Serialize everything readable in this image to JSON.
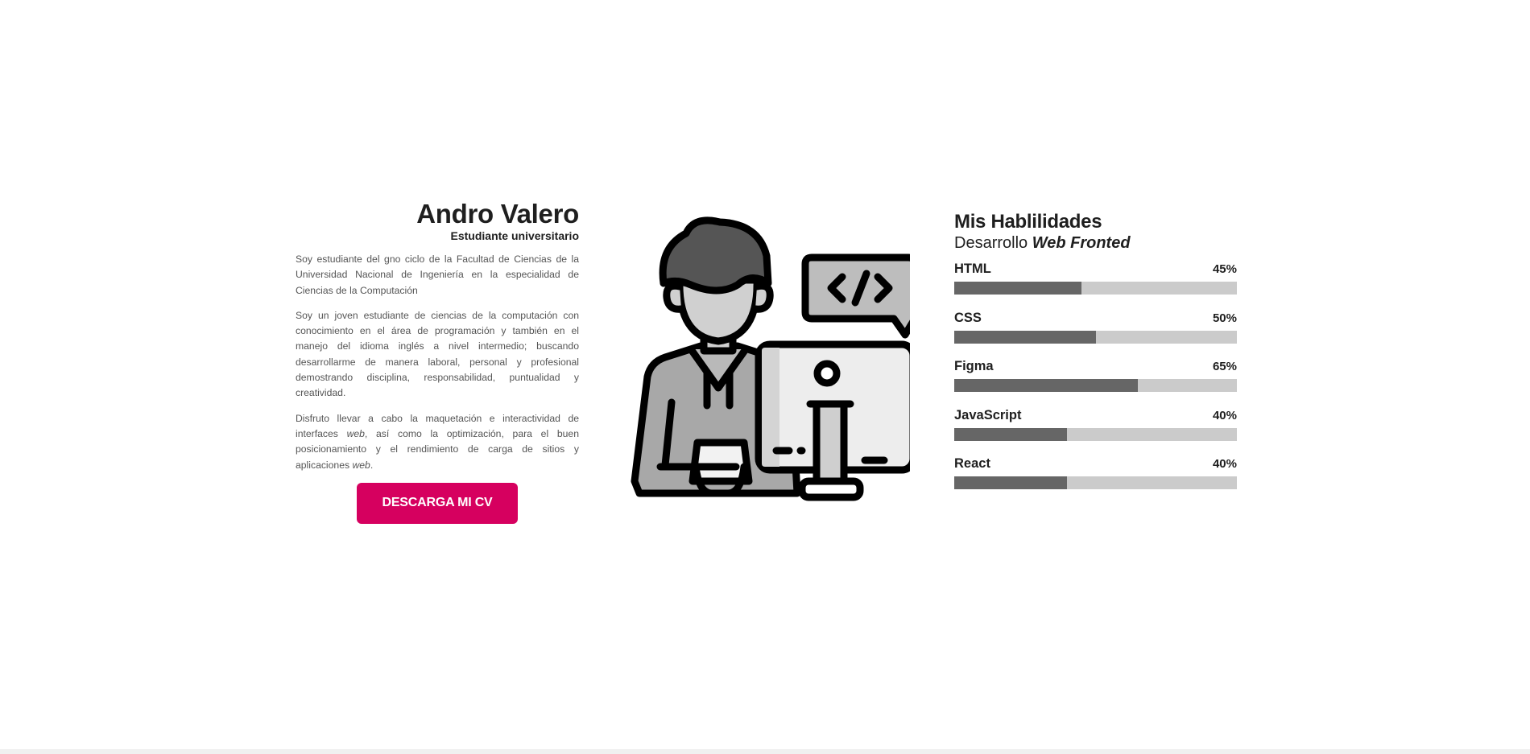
{
  "profile": {
    "name": "Andro Valero",
    "role": "Estudiante universitario",
    "paragraph_1": "Soy estudiante del gno ciclo de la Facultad de Ciencias de la Universidad Nacional de Ingeniería en la especialidad de Ciencias de la Computación",
    "paragraph_2": "Soy un joven estudiante de ciencias de la computación con conocimiento en el área de programación y también en el manejo del idioma inglés a nivel intermedio; buscando desarrollarme de manera laboral, personal y profesional demostrando disciplina, responsabilidad, puntualidad y creatividad.",
    "paragraph_3": {
      "part_1": "Disfruto llevar a cabo la maquetación e interactividad de interfaces ",
      "em_1": "web",
      "part_2": ", así como la optimización, para el buen posicionamiento y el rendimiento de carga de sitios y aplicaciones ",
      "em_2": "web",
      "part_3": "."
    },
    "cv_button_label": "DESCARGA MI CV"
  },
  "illustration": {
    "icon": "developer-at-computer-icon",
    "code_bubble_text": "</>"
  },
  "skills": {
    "title": "Mis Hablilidades",
    "subtitle_prefix": "Desarrollo ",
    "subtitle_emphasis": "Web Fronted",
    "items": [
      {
        "name": "HTML",
        "percent_label": "45%",
        "level": 0.45
      },
      {
        "name": "CSS",
        "percent_label": "50%",
        "level": 0.5
      },
      {
        "name": "Figma",
        "percent_label": "65%",
        "level": 0.65
      },
      {
        "name": "JavaScript",
        "percent_label": "40%",
        "level": 0.4
      },
      {
        "name": "React",
        "percent_label": "40%",
        "level": 0.4
      }
    ]
  },
  "colors": {
    "accent": "#d6005f",
    "bar_track": "#cbcbcb",
    "bar_fill": "#666666",
    "text": "#1f1f1f"
  }
}
